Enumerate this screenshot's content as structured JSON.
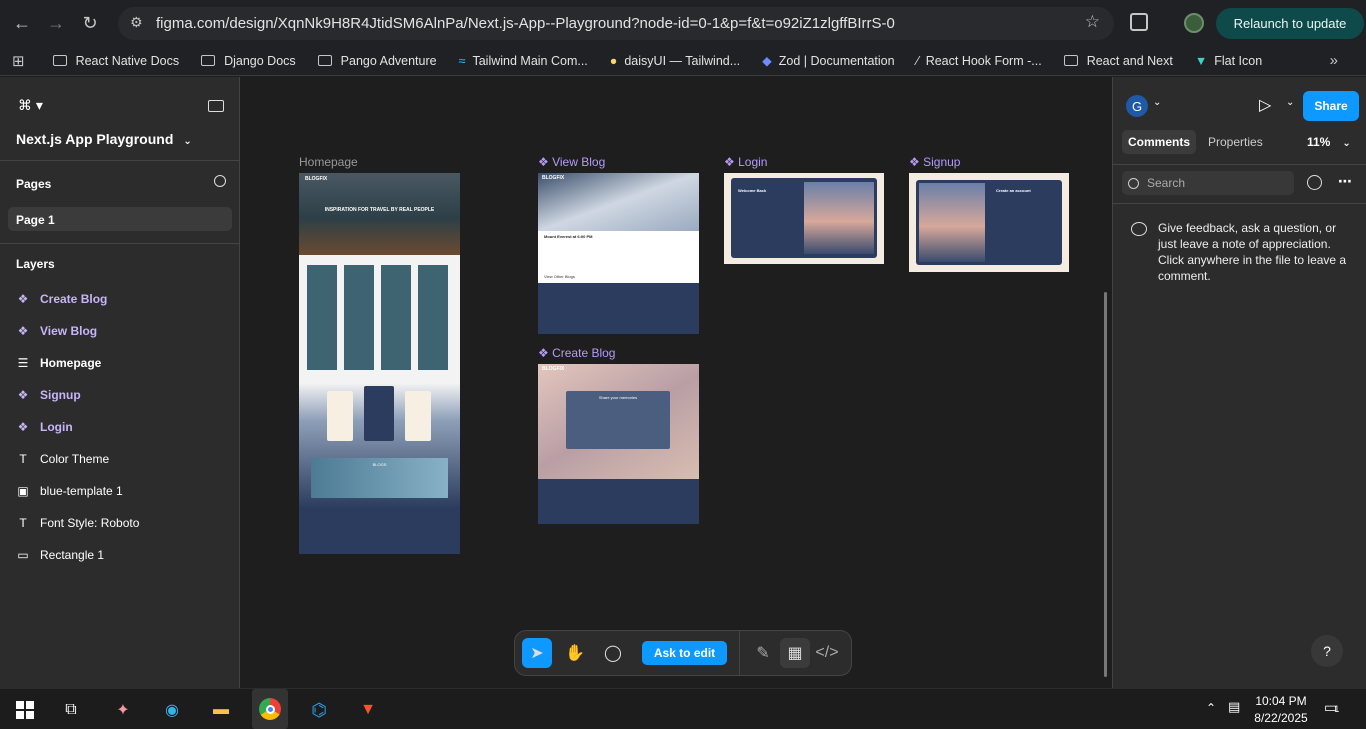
{
  "browser": {
    "url": "figma.com/design/XqnNk9H8R4JtidSM6AlnPa/Next.js-App--Playground?node-id=0-1&p=f&t=o92iZ1zlgffBIrrS-0",
    "relaunch_label": "Relaunch to update",
    "bookmarks": [
      "React Native Docs",
      "Django Docs",
      "Pango Adventure",
      "Tailwind Main Com...",
      "daisyUI — Tailwind...",
      "Zod | Documentation",
      "React Hook Form -...",
      "React and Next",
      "Flat Icon"
    ]
  },
  "left_panel": {
    "file_name": "Next.js App Playground",
    "pages_title": "Pages",
    "current_page": "Page 1",
    "layers_title": "Layers",
    "layers": [
      {
        "label": "Create Blog",
        "kind": "component"
      },
      {
        "label": "View Blog",
        "kind": "component"
      },
      {
        "label": "Homepage",
        "kind": "frame"
      },
      {
        "label": "Signup",
        "kind": "component"
      },
      {
        "label": "Login",
        "kind": "component"
      },
      {
        "label": "Color Theme",
        "kind": "text"
      },
      {
        "label": "blue-template 1",
        "kind": "image"
      },
      {
        "label": "Font Style: Roboto",
        "kind": "text"
      },
      {
        "label": "Rectangle 1",
        "kind": "rect"
      }
    ]
  },
  "canvas": {
    "frames": {
      "homepage": "Homepage",
      "viewblog": "View Blog",
      "login": "Login",
      "signup": "Signup",
      "createblog": "Create Blog"
    },
    "thumb": {
      "brand": "BLOGFIX",
      "hero": "INSPIRATION FOR TRAVEL BY REAL PEOPLE",
      "blog_title": "Mount Everest at 6:00 PM",
      "other_blogs": "View Other Blogs",
      "welcome": "Welcome Back",
      "create_account": "Create an account",
      "share": "Share your memories",
      "blogs": "BLOGS"
    }
  },
  "right_panel": {
    "avatar_letter": "G",
    "share_label": "Share",
    "tabs": [
      "Comments",
      "Properties"
    ],
    "zoom": "11%",
    "search_placeholder": "Search",
    "hint": "Give feedback, ask a question, or just leave a note of appreciation. Click anywhere in the file to leave a comment.",
    "help": "?"
  },
  "toolbar": {
    "ask_label": "Ask to edit"
  },
  "taskbar": {
    "time": "10:04 PM",
    "date": "8/22/2025",
    "notifications": "1"
  }
}
